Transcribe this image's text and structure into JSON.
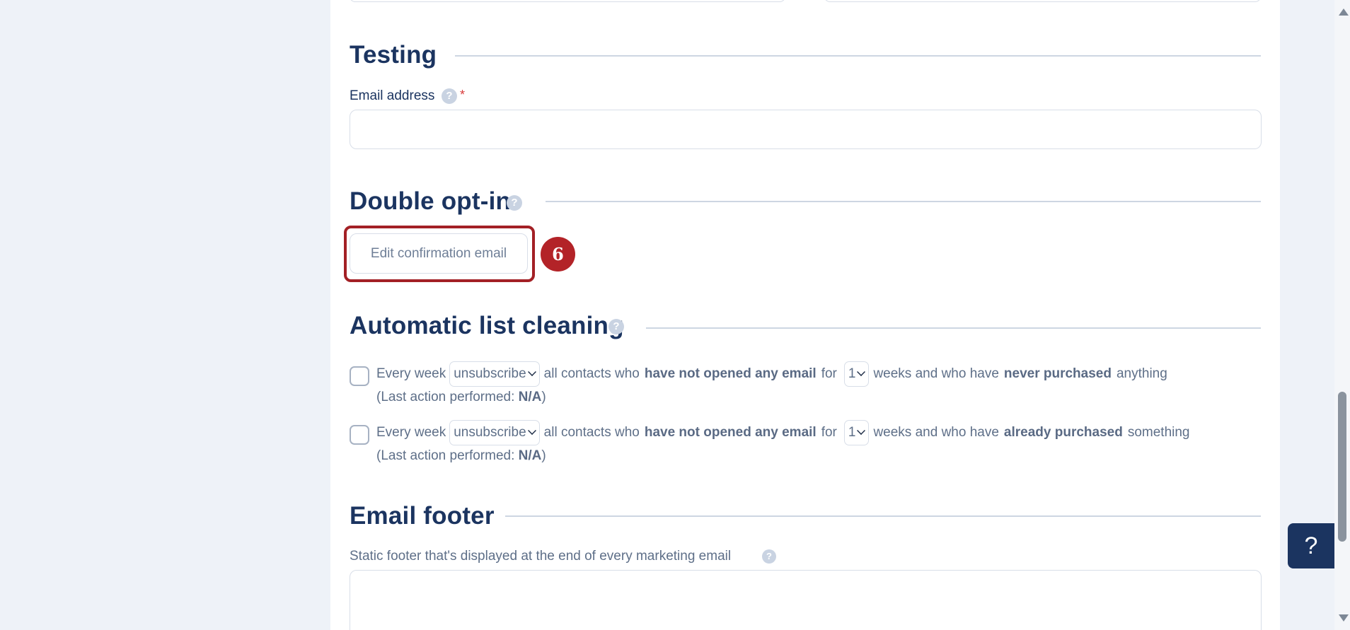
{
  "sections": {
    "testing": {
      "title": "Testing",
      "email_label": "Email address",
      "required_mark": "*",
      "help_icon": "?",
      "email_value": ""
    },
    "double_opt_in": {
      "title": "Double opt-in",
      "help_icon": "?",
      "edit_button_label": "Edit confirmation email",
      "step_badge": "6"
    },
    "list_cleaning": {
      "title": "Automatic list cleaning",
      "help_icon": "?",
      "rules": [
        {
          "checked": false,
          "prefix": "Every week",
          "action_value": "unsubscribe",
          "middle": "all contacts who",
          "emphasis_1": "have not opened any email",
          "for_text": "for",
          "weeks_value": "1",
          "after_weeks": "weeks and who have",
          "emphasis_2": "never purchased",
          "suffix": "anything",
          "last_action_prefix": "(Last action performed: ",
          "last_action_value": "N/A",
          "last_action_suffix": ")"
        },
        {
          "checked": false,
          "prefix": "Every week",
          "action_value": "unsubscribe",
          "middle": "all contacts who",
          "emphasis_1": "have not opened any email",
          "for_text": "for",
          "weeks_value": "1",
          "after_weeks": "weeks and who have",
          "emphasis_2": "already purchased",
          "suffix": "something",
          "last_action_prefix": "(Last action performed: ",
          "last_action_value": "N/A",
          "last_action_suffix": ")"
        }
      ]
    },
    "email_footer": {
      "title": "Email footer",
      "static_footer_label": "Static footer that's displayed at the end of every marketing email",
      "help_icon": "?",
      "footer_value": ""
    }
  },
  "help_widget": {
    "label": "?"
  },
  "colors": {
    "heading": "#1b3460",
    "highlight": "#a32025",
    "badge": "#b32328",
    "background": "#eef2f8"
  }
}
